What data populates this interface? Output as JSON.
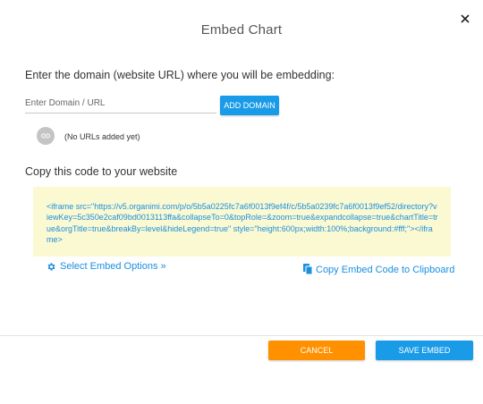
{
  "modal": {
    "title": "Embed Chart"
  },
  "domain": {
    "prompt": "Enter the domain (website URL) where you will be embedding:",
    "input_placeholder": "Enter Domain / URL",
    "input_value": "",
    "add_button_label": "ADD DOMAIN",
    "empty_message": "(No URLs added yet)"
  },
  "code": {
    "heading": "Copy this code to your website",
    "snippet": "<iframe src=\"https://v5.organimi.com/p/o/5b5a0225fc7a6f0013f9ef4f/c/5b5a0239fc7a6f0013f9ef52/directory?viewKey=5c350e2caf09bd0013113ffa&collapseTo=0&topRole=&zoom=true&expandcollapse=true&chartTitle=true&orgTitle=true&breakBy=level&hideLegend=true\" style=\"height:600px;width:100%;background:#fff;\"></iframe>"
  },
  "links": {
    "embed_options_label": "Select Embed Options »",
    "copy_clipboard_label": "Copy Embed Code to Clipboard"
  },
  "footer": {
    "cancel_label": "CANCEL",
    "save_label": "SAVE EMBED"
  },
  "icons": {
    "close": "close-icon",
    "link": "link-icon",
    "gear": "gear-icon",
    "copy": "copy-icon"
  },
  "colors": {
    "primary": "#1a9be8",
    "link": "#1a8fe0",
    "cancel": "#ff9100",
    "code_background": "#fbf9d2"
  }
}
